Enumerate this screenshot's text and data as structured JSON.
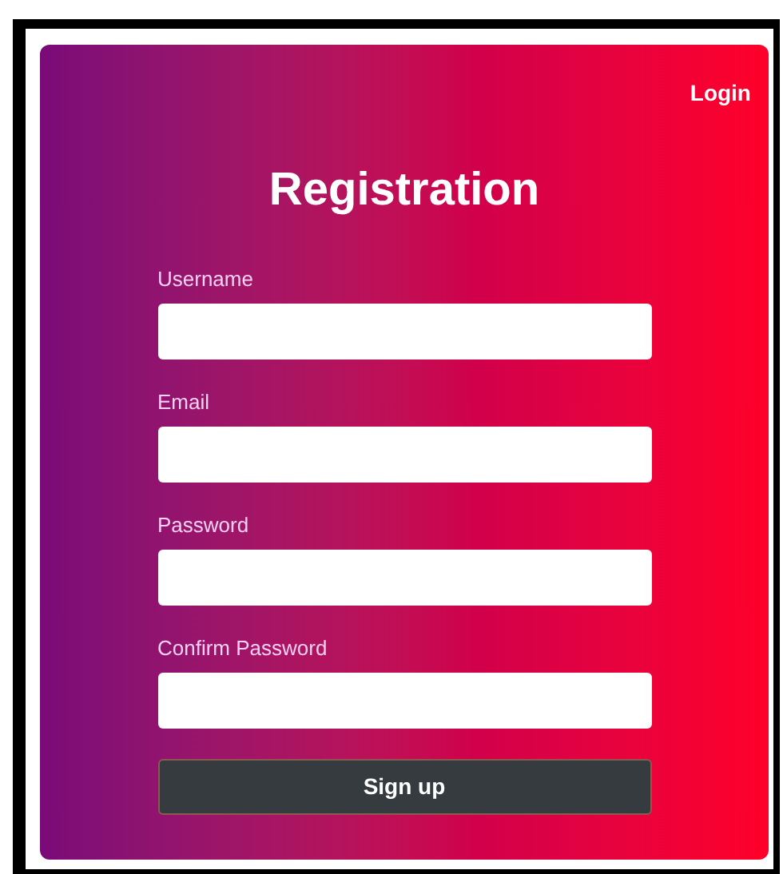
{
  "nav": {
    "login_link": "Login"
  },
  "title": "Registration",
  "fields": [
    {
      "label": "Username"
    },
    {
      "label": "Email"
    },
    {
      "label": "Password"
    },
    {
      "label": "Confirm Password"
    }
  ],
  "submit_button": "Sign up"
}
